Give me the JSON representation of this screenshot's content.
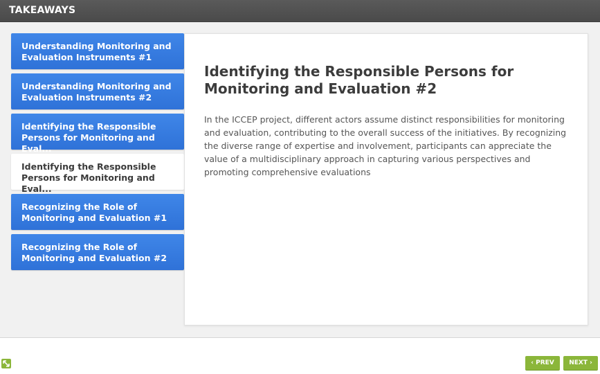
{
  "header": {
    "title": "TAKEAWAYS"
  },
  "sidebar": {
    "items": [
      {
        "label": "Understanding Monitoring and Evaluation Instruments #1",
        "active": false
      },
      {
        "label": "Understanding Monitoring and Evaluation Instruments #2",
        "active": false
      },
      {
        "label": "Identifying the Responsible Persons for Monitoring and Eval...",
        "active": false
      },
      {
        "label": "Identifying the Responsible Persons for Monitoring and Eval...",
        "active": true
      },
      {
        "label": "Recognizing the Role of Monitoring and Evaluation #1",
        "active": false
      },
      {
        "label": "Recognizing the Role of Monitoring and Evaluation #2",
        "active": false
      }
    ]
  },
  "main": {
    "title": "Identifying the Responsible Persons for Monitoring and Evaluation #2",
    "body": "In the ICCEP project, different actors assume distinct responsibilities for monitoring and evaluation, contributing to the overall success of the initiatives. By recognizing the diverse range of expertise and involvement, participants can appreciate the value of a multidisciplinary approach in capturing various perspectives and promoting comprehensive evaluations"
  },
  "footer": {
    "prev_label": "PREV",
    "next_label": "NEXT",
    "resize_icon": "resize-arrows-icon",
    "prev_icon": "chevron-left-icon",
    "next_icon": "chevron-right-icon"
  },
  "colors": {
    "header_bg": "#4f4f4f",
    "tab_blue": "#3a7fe2",
    "nav_green": "#8bb63a"
  }
}
